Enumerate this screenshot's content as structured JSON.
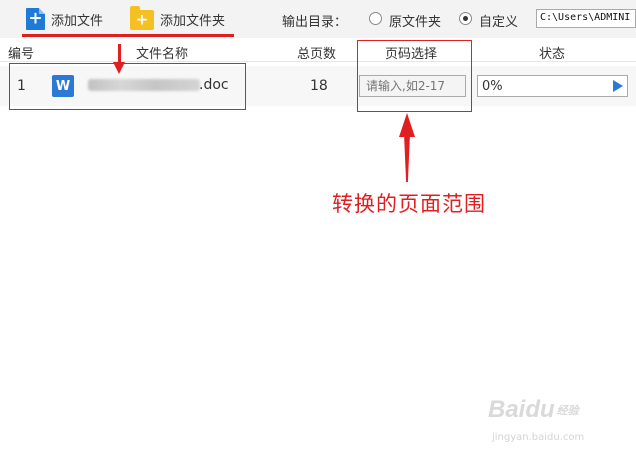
{
  "toolbar": {
    "add_file_label": "添加文件",
    "add_folder_label": "添加文件夹",
    "output_dir_label": "输出目录：",
    "output_options": [
      {
        "label": "原文件夹",
        "selected": false
      },
      {
        "label": "自定义",
        "selected": true
      }
    ],
    "output_path": "C:\\Users\\ADMINI"
  },
  "table": {
    "headers": [
      "编号",
      "文件名称",
      "总页数",
      "页码选择",
      "状态"
    ],
    "rows": [
      {
        "index": "1",
        "file_icon_letter": "W",
        "file_name_visible": ".doc",
        "total_pages": "18",
        "range_placeholder": "请输入,如2-17",
        "progress_text": "0%",
        "progress": 0
      }
    ]
  },
  "annotation": {
    "text": "转换的页面范围",
    "color": "#e02020"
  },
  "watermark": {
    "logo": "Baidu",
    "sub": "经验",
    "url": "jingyan.baidu.com"
  },
  "colors": {
    "accent_blue": "#2b79d4",
    "folder_yellow": "#f5c022",
    "annotation_red": "#e02020"
  }
}
